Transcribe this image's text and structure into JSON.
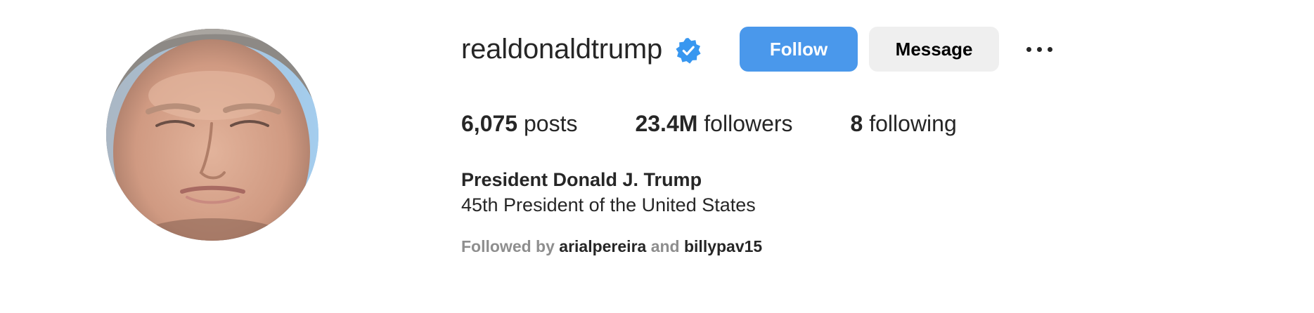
{
  "profile": {
    "username": "realdonaldtrump",
    "verified_icon": "verified-badge-icon",
    "follow_label": "Follow",
    "message_label": "Message",
    "more_icon": "more-options-icon"
  },
  "stats": {
    "posts_count": "6,075",
    "posts_label": "posts",
    "followers_count": "23.4M",
    "followers_label": "followers",
    "following_count": "8",
    "following_label": "following"
  },
  "bio": {
    "full_name": "President Donald J. Trump",
    "description": "45th President of the United States"
  },
  "followed_by": {
    "prefix": "Followed by",
    "user1": "arialpereira",
    "conjunction": "and",
    "user2": "billypav15"
  },
  "colors": {
    "follow_button": "#4a98eb",
    "message_button": "#efefef",
    "verified_badge": "#3897f0",
    "muted_text": "#8e8e8e"
  }
}
